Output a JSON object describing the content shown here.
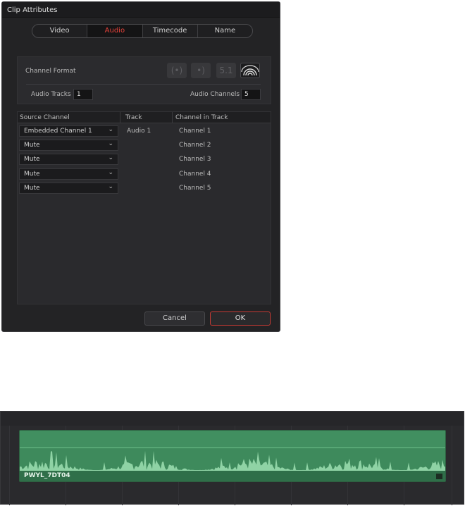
{
  "dialog": {
    "title": "Clip Attributes",
    "tabs": [
      {
        "label": "Video",
        "active": false
      },
      {
        "label": "Audio",
        "active": true
      },
      {
        "label": "Timecode",
        "active": false
      },
      {
        "label": "Name",
        "active": false
      }
    ],
    "channel_format": {
      "label": "Channel Format",
      "buttons": [
        {
          "name": "stereo-icon",
          "glyph": "(•)",
          "active": false
        },
        {
          "name": "mono-icon",
          "glyph": "•)",
          "active": false
        },
        {
          "name": "surround-icon",
          "glyph": "5.1",
          "active": false
        },
        {
          "name": "adaptive-icon",
          "glyph": "≋",
          "active": true
        }
      ]
    },
    "audio_tracks": {
      "label": "Audio Tracks",
      "value": "1"
    },
    "audio_channels": {
      "label": "Audio Channels",
      "value": "5"
    },
    "grid": {
      "headers": [
        "Source Channel",
        "Track",
        "Channel in Track"
      ],
      "rows": [
        {
          "source": "Embedded Channel 1",
          "track": "Audio 1",
          "channel": "Channel 1"
        },
        {
          "source": "Mute",
          "track": "",
          "channel": "Channel 2"
        },
        {
          "source": "Mute",
          "track": "",
          "channel": "Channel 3"
        },
        {
          "source": "Mute",
          "track": "",
          "channel": "Channel 4"
        },
        {
          "source": "Mute",
          "track": "",
          "channel": "Channel 5"
        }
      ]
    },
    "cancel_label": "Cancel",
    "ok_label": "OK"
  },
  "timeline": {
    "clip_name": "PWYL_7DT04"
  },
  "colors": {
    "accent_red": "#e6423a",
    "clip_green": "#3e8a5c",
    "waveform_green": "#8fd3a5"
  }
}
